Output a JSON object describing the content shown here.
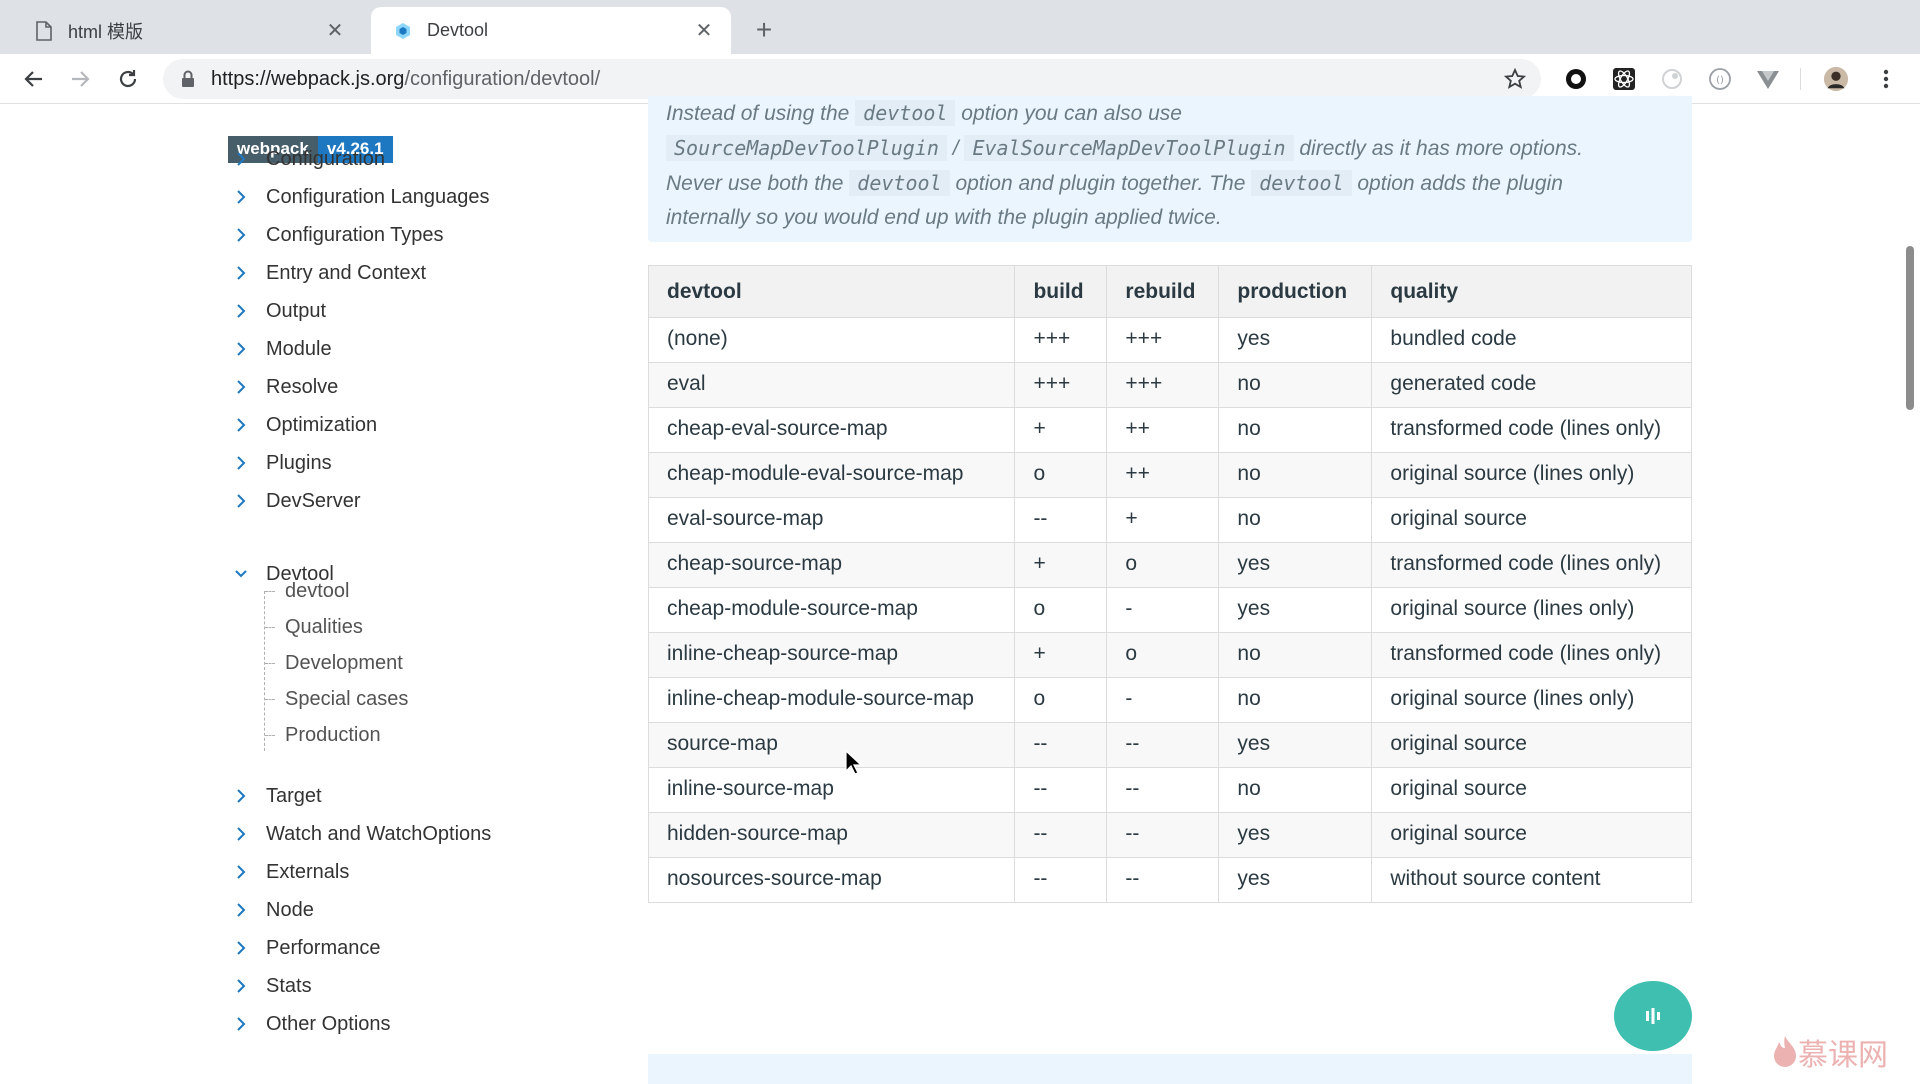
{
  "browser": {
    "tabs": [
      {
        "title": "html 模版",
        "active": false,
        "icon": "document-icon"
      },
      {
        "title": "Devtool",
        "active": true,
        "icon": "webpack-icon"
      }
    ],
    "url_host": "https://webpack.js.org",
    "url_path": "/configuration/devtool/",
    "new_tab_label": "+"
  },
  "sidebar": {
    "badge_name": "webpack",
    "badge_version": "v4.26.1",
    "items_top": [
      "Configuration",
      "Configuration Languages",
      "Configuration Types",
      "Entry and Context",
      "Output",
      "Module",
      "Resolve",
      "Optimization",
      "Plugins",
      "DevServer"
    ],
    "expanded_item": "Devtool",
    "sub_items": [
      "devtool",
      "Qualities",
      "Development",
      "Special cases",
      "Production"
    ],
    "items_bottom": [
      "Target",
      "Watch and WatchOptions",
      "Externals",
      "Node",
      "Performance",
      "Stats",
      "Other Options"
    ]
  },
  "tip": {
    "l1_a": "Instead of using the",
    "l1_code": "devtool",
    "l1_b": "option you can also use",
    "l2_code1": "SourceMapDevToolPlugin",
    "l2_sep": "/",
    "l2_code2": "EvalSourceMapDevToolPlugin",
    "l2_b": "directly as it has more options.",
    "l3_a": "Never use both the",
    "l3_code1": "devtool",
    "l3_b": "option and plugin together. The",
    "l3_code2": "devtool",
    "l3_c": "option adds the plugin",
    "l4": "internally so you would end up with the plugin applied twice."
  },
  "table": {
    "headers": [
      "devtool",
      "build",
      "rebuild",
      "production",
      "quality"
    ],
    "rows": [
      [
        "(none)",
        "+++",
        "+++",
        "yes",
        "bundled code"
      ],
      [
        "eval",
        "+++",
        "+++",
        "no",
        "generated code"
      ],
      [
        "cheap-eval-source-map",
        "+",
        "++",
        "no",
        "transformed code (lines only)"
      ],
      [
        "cheap-module-eval-source-map",
        "o",
        "++",
        "no",
        "original source (lines only)"
      ],
      [
        "eval-source-map",
        "--",
        "+",
        "no",
        "original source"
      ],
      [
        "cheap-source-map",
        "+",
        "o",
        "yes",
        "transformed code (lines only)"
      ],
      [
        "cheap-module-source-map",
        "o",
        "-",
        "yes",
        "original source (lines only)"
      ],
      [
        "inline-cheap-source-map",
        "+",
        "o",
        "no",
        "transformed code (lines only)"
      ],
      [
        "inline-cheap-module-source-map",
        "o",
        "-",
        "no",
        "original source (lines only)"
      ],
      [
        "source-map",
        "--",
        "--",
        "yes",
        "original source"
      ],
      [
        "inline-source-map",
        "--",
        "--",
        "no",
        "original source"
      ],
      [
        "hidden-source-map",
        "--",
        "--",
        "yes",
        "original source"
      ],
      [
        "nosources-source-map",
        "--",
        "--",
        "yes",
        "without source content"
      ]
    ]
  },
  "watermark": "慕课网",
  "colors": {
    "badge_version": "#1d78c1",
    "badge_name": "#465e69",
    "tip_bg": "#eaf5fd",
    "float_button": "#3fbfb0"
  }
}
